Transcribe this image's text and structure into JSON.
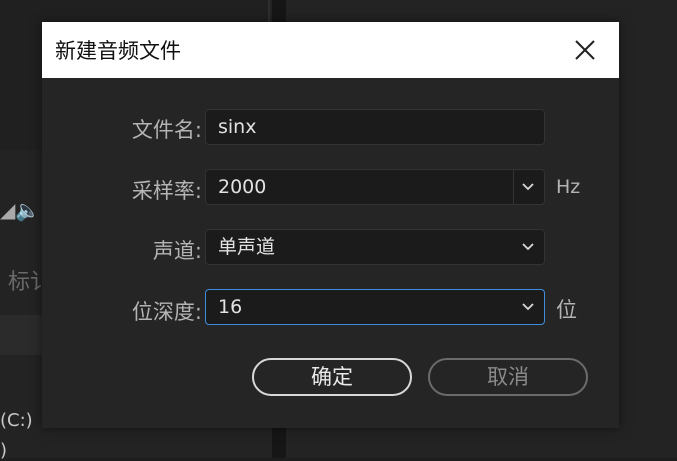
{
  "background": {
    "tab_fragment": "标讠",
    "drive_label": "(C:)",
    "drive_label_2": ")"
  },
  "dialog": {
    "title": "新建音频文件",
    "close_icon": "close-icon",
    "fields": {
      "filename": {
        "label": "文件名:",
        "value": "sinx"
      },
      "sample_rate": {
        "label": "采样率:",
        "value": "2000",
        "unit": "Hz"
      },
      "channels": {
        "label": "声道:",
        "value": "单声道"
      },
      "bit_depth": {
        "label": "位深度:",
        "value": "16",
        "unit": "位"
      }
    },
    "buttons": {
      "ok": "确定",
      "cancel": "取消"
    }
  },
  "colors": {
    "dialog_bg": "#252525",
    "field_bg": "#1b1b1b",
    "focus_border": "#3e8ddd",
    "titlebar_bg": "#ffffff"
  }
}
